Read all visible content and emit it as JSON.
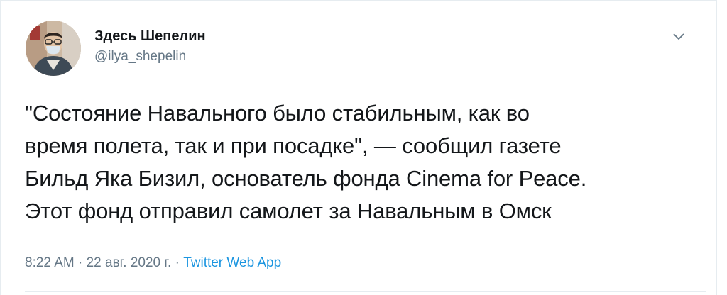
{
  "tweet": {
    "author": {
      "display_name": "Здесь Шепелин",
      "handle": "@ilya_shepelin"
    },
    "text": "\"Состояние Навального было стабильным, как во\nвремя полета, так и при посадке\", — сообщил газете\nБильд Яка Бизил, основатель фонда Cinema for Peace.\nЭтот фонд отправил самолет за Навальным в Омск",
    "time": "8:22 AM",
    "separator": "·",
    "date": "22 авг. 2020 г.",
    "source": "Twitter Web App"
  },
  "icons": {
    "menu": "chevron-down-icon",
    "avatar": "profile-photo"
  },
  "colors": {
    "text": "#14171a",
    "secondary": "#657786",
    "link": "#1b95e0",
    "border": "#e6ecf0"
  }
}
